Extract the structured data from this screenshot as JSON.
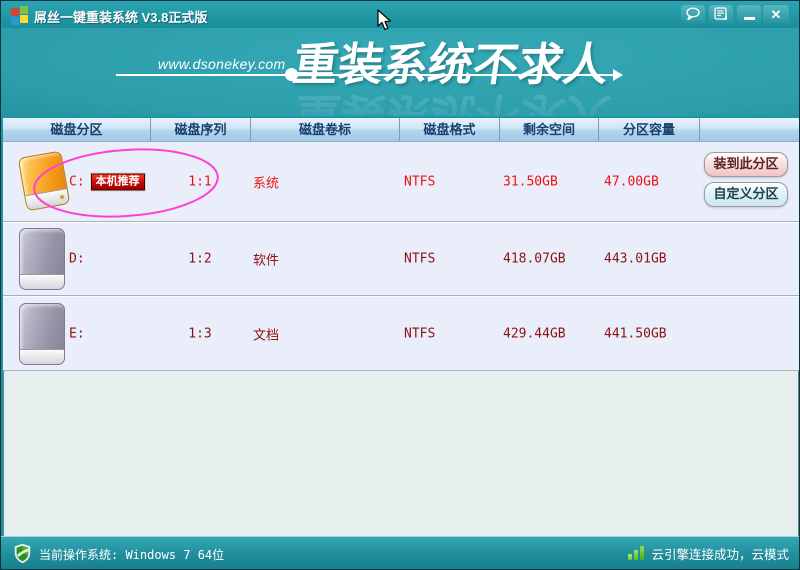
{
  "window": {
    "title": "屌丝一键重装系统 V3.8正式版",
    "controls": {
      "chat_icon": "speech-bubble",
      "form_icon": "feedback-form",
      "minimize_icon": "minimize-bar",
      "close_glyph": "✕"
    }
  },
  "banner": {
    "website": "www.dsonekey.com",
    "slogan": "重装系统不求人"
  },
  "table": {
    "headers": [
      "磁盘分区",
      "磁盘序列",
      "磁盘卷标",
      "磁盘格式",
      "剩余空间",
      "分区容量"
    ],
    "rows": [
      {
        "letter": "C:",
        "badge": "本机推荐",
        "serial": "1:1",
        "label": "系统",
        "format": "NTFS",
        "free": "31.50GB",
        "capacity": "47.00GB"
      },
      {
        "letter": "D:",
        "serial": "1:2",
        "label": "软件",
        "format": "NTFS",
        "free": "418.07GB",
        "capacity": "443.01GB"
      },
      {
        "letter": "E:",
        "serial": "1:3",
        "label": "文档",
        "format": "NTFS",
        "free": "429.44GB",
        "capacity": "441.50GB"
      }
    ],
    "actions": {
      "install": "装到此分区",
      "custom": "自定义分区"
    }
  },
  "statusbar": {
    "os_label": "当前操作系统: Windows 7 64位",
    "cloud_status": "云引擎连接成功，云模式"
  },
  "colors": {
    "titlebar_teal": "#1d96a3",
    "header_text_navy": "#17406e",
    "selected_row_red": "#ee1111",
    "row_text_maroon": "#8b1212",
    "badge_red": "#c00808",
    "annotation_pink": "#ff40d0",
    "install_button_pink": "#f2c3c3",
    "custom_button_blue": "#cde8f1",
    "status_green": "#46b115"
  }
}
